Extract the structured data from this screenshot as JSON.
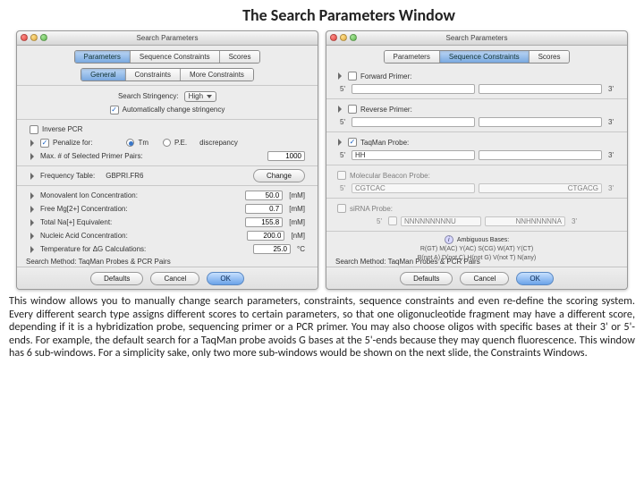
{
  "title": "The Search Parameters Window",
  "left_panel": {
    "window_title": "Search Parameters",
    "main_tabs": {
      "parameters": "Parameters",
      "seq": "Sequence Constraints",
      "scores": "Scores"
    },
    "sub_tabs": {
      "general": "General",
      "constraints": "Constraints",
      "more": "More Constraints"
    },
    "stringency_label": "Search Stringency:",
    "stringency_value": "High",
    "auto_change": "Automatically change stringency",
    "inverse_pcr": "Inverse PCR",
    "penalize_for": "Penalize for:",
    "penalize_tm": "Tm",
    "penalize_pe": "P.E.",
    "discrepancy": "discrepancy",
    "max_pairs_label": "Max. # of Selected Primer Pairs:",
    "max_pairs_val": "1000",
    "freq_table_label": "Frequency Table:",
    "freq_table_val": "GBPRI.FR6",
    "change_btn": "Change",
    "rows": {
      "mono": {
        "label": "Monovalent Ion Concentration:",
        "val": "50.0",
        "unit": "[mM]"
      },
      "mg": {
        "label": "Free Mg[2+] Concentration:",
        "val": "0.7",
        "unit": "[mM]"
      },
      "na": {
        "label": "Total Na[+] Equivalent:",
        "val": "155.8",
        "unit": "[mM]"
      },
      "nuc": {
        "label": "Nucleic Acid Concentration:",
        "val": "200.0",
        "unit": "[nM]"
      },
      "temp": {
        "label": "Temperature for ΔG Calculations:",
        "val": "25.0",
        "unit": "°C"
      }
    },
    "search_method_label": "Search Method:",
    "search_method_val": "TaqMan Probes & PCR Pairs",
    "defaults": "Defaults",
    "cancel": "Cancel",
    "ok": "OK"
  },
  "right_panel": {
    "window_title": "Search Parameters",
    "main_tabs": {
      "parameters": "Parameters",
      "seq": "Sequence Constraints",
      "scores": "Scores"
    },
    "forward": "Forward Primer:",
    "reverse": "Reverse Primer:",
    "taqman": "TaqMan Probe:",
    "taqman5": "HH",
    "molbeacon": "Molecular Beacon Probe:",
    "mb5": "CGTCAC",
    "mb3": "CTGACG",
    "sirna": "siRNA Probe:",
    "si5": "NNNNNNNNNU",
    "si3": "NNHNNNNNA",
    "five": "5'",
    "three": "3'",
    "amb_title": "Ambiguous Bases:",
    "amb_l1": "R(GT)  M(AC)  Y(AC)  S(CG)  W(AT)  Y(CT)",
    "amb_l2": "B(not A)  D(not C)  H(not G)  V(not T)  N(any)",
    "search_method_label": "Search Method:",
    "search_method_val": "TaqMan Probes & PCR Pairs",
    "defaults": "Defaults",
    "cancel": "Cancel",
    "ok": "OK"
  },
  "paragraph": "This window allows you to manually change search parameters, constraints, sequence constraints and even re-define the scoring system. Every different search type assigns different scores to certain parameters, so that one oligonucleotide fragment may have a different score, depending if it is a hybridization probe, sequencing primer or a PCR primer. You may also choose oligos with specific bases at their 3' or 5'-ends. For example, the default search for a TaqMan probe avoids G bases at the 5'-ends because they may quench fluorescence. This window has 6 sub-windows. For a simplicity sake, only two more sub-windows would be shown on the next slide, the Constraints Windows."
}
